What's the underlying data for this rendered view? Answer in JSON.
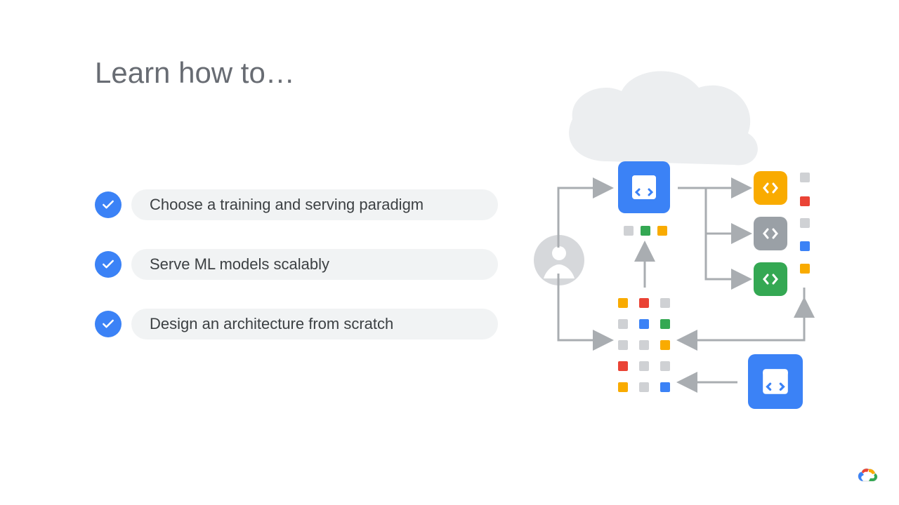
{
  "title": "Learn how to…",
  "bullets": [
    "Choose a training and serving paradigm",
    "Serve ML models scalably",
    "Design an architecture from scratch"
  ],
  "colors": {
    "blue": "#3b82f6",
    "yellow": "#f9ab00",
    "green": "#34a853",
    "red": "#ea4335",
    "gray": "#cfd1d4",
    "midgray": "#9aa0a6",
    "lightGray": "#eceef0"
  }
}
